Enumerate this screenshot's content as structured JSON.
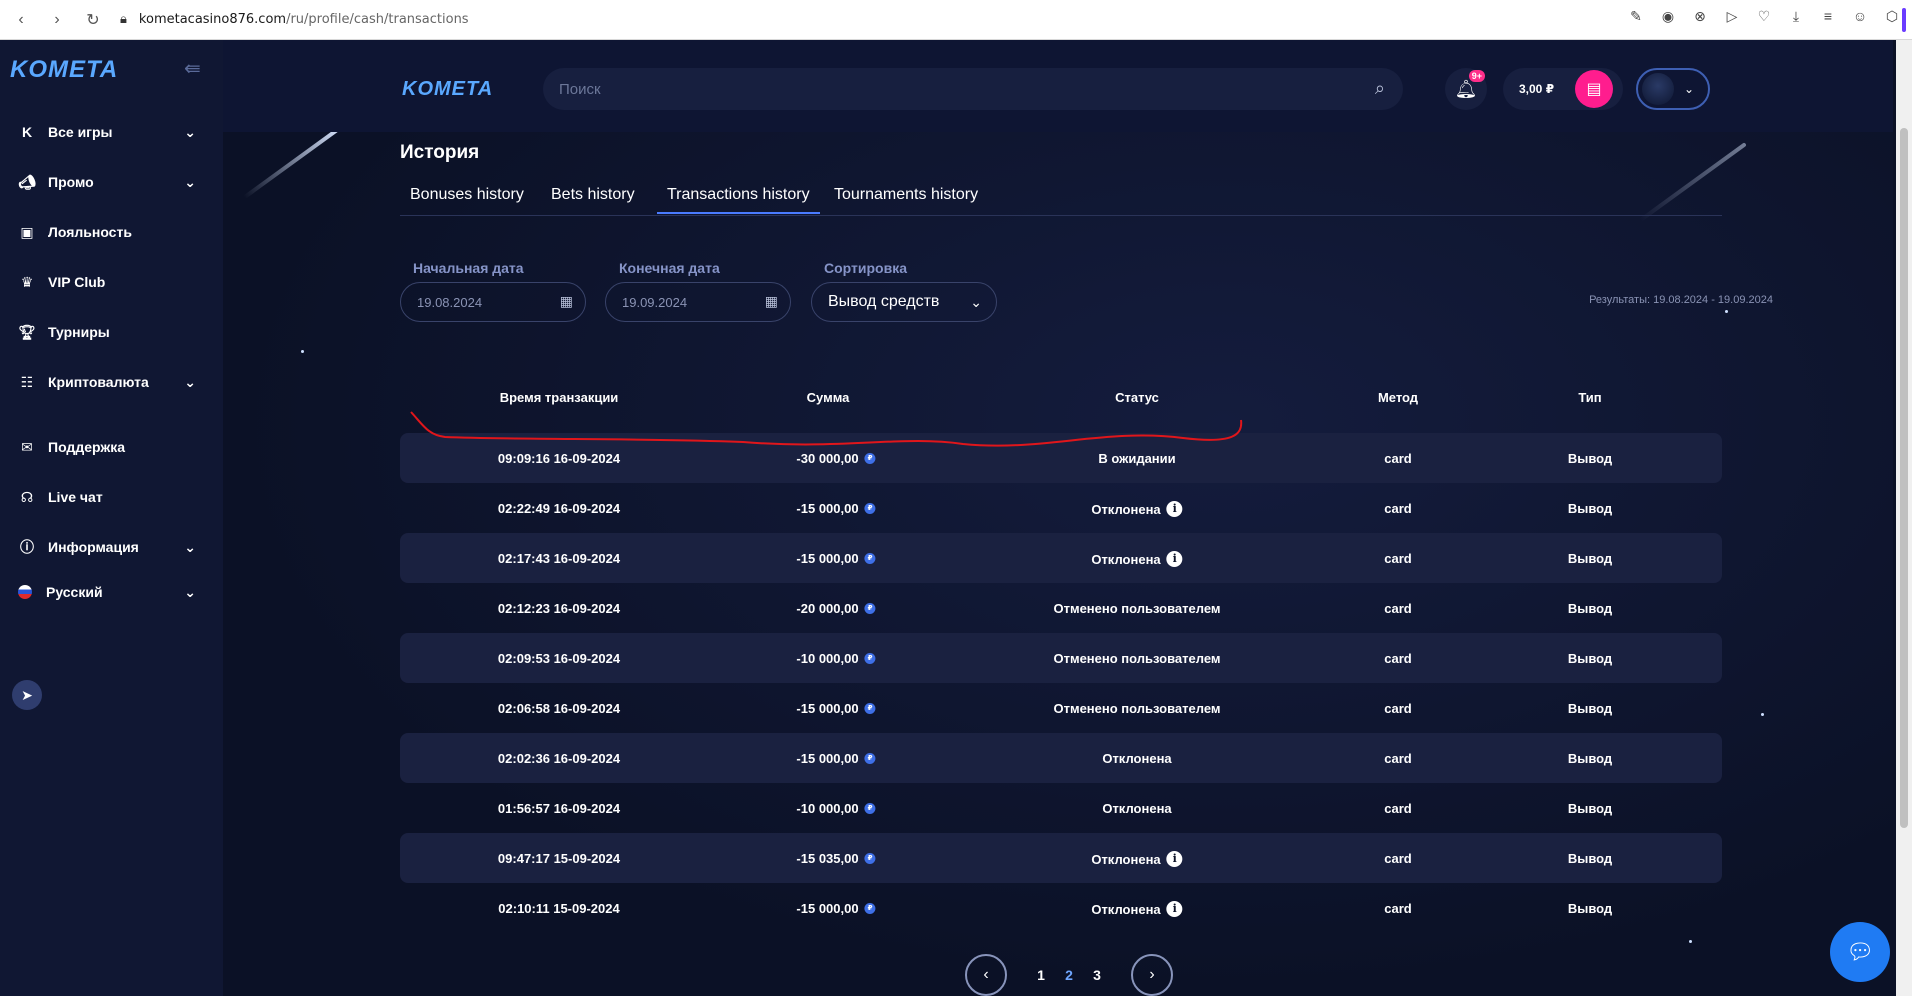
{
  "browser": {
    "url_host": "kometacasino876.com",
    "url_path": "/ru/profile/cash/transactions"
  },
  "brand": {
    "logo": "KOMETA"
  },
  "sidebar": {
    "items": [
      {
        "label": "Все игры",
        "icon": "k-icon",
        "expandable": true
      },
      {
        "label": "Промо",
        "icon": "megaphone-icon",
        "expandable": true
      },
      {
        "label": "Лояльность",
        "icon": "loyalty-icon",
        "expandable": false
      },
      {
        "label": "VIP Club",
        "icon": "crown-icon",
        "expandable": false
      },
      {
        "label": "Турниры",
        "icon": "trophy-icon",
        "expandable": false
      },
      {
        "label": "Криптовалюта",
        "icon": "crypto-icon",
        "expandable": true
      },
      {
        "label": "Поддержка",
        "icon": "support-icon",
        "expandable": false
      },
      {
        "label": "Live чат",
        "icon": "headset-icon",
        "expandable": false
      },
      {
        "label": "Информация",
        "icon": "info-icon",
        "expandable": true
      },
      {
        "label": "Русский",
        "icon": "flag-ru-icon",
        "expandable": true
      }
    ]
  },
  "header": {
    "search_placeholder": "Поиск",
    "notif_badge": "9+",
    "balance": "3,00 ₽"
  },
  "page": {
    "title": "История",
    "tabs": [
      {
        "label": "Bonuses history",
        "active": false
      },
      {
        "label": "Bets history",
        "active": false
      },
      {
        "label": "Transactions history",
        "active": true
      },
      {
        "label": "Tournaments history",
        "active": false
      }
    ]
  },
  "filters": {
    "start_label": "Начальная дата",
    "start_value": "19.08.2024",
    "end_label": "Конечная дата",
    "end_value": "19.09.2024",
    "sort_label": "Сортировка",
    "sort_value": "Вывод средств",
    "results": "Результаты: 19.08.2024 - 19.09.2024"
  },
  "table": {
    "columns": [
      "Время транзакции",
      "Сумма",
      "Статус",
      "Метод",
      "Тип"
    ],
    "rows": [
      {
        "time": "09:09:16 16-09-2024",
        "amount": "-30 000,00",
        "status": "В ожидании",
        "info": false,
        "method": "card",
        "type": "Вывод"
      },
      {
        "time": "02:22:49 16-09-2024",
        "amount": "-15 000,00",
        "status": "Отклонена",
        "info": true,
        "method": "card",
        "type": "Вывод"
      },
      {
        "time": "02:17:43 16-09-2024",
        "amount": "-15 000,00",
        "status": "Отклонена",
        "info": true,
        "method": "card",
        "type": "Вывод"
      },
      {
        "time": "02:12:23 16-09-2024",
        "amount": "-20 000,00",
        "status": "Отменено пользователем",
        "info": false,
        "method": "card",
        "type": "Вывод"
      },
      {
        "time": "02:09:53 16-09-2024",
        "amount": "-10 000,00",
        "status": "Отменено пользователем",
        "info": false,
        "method": "card",
        "type": "Вывод"
      },
      {
        "time": "02:06:58 16-09-2024",
        "amount": "-15 000,00",
        "status": "Отменено пользователем",
        "info": false,
        "method": "card",
        "type": "Вывод"
      },
      {
        "time": "02:02:36 16-09-2024",
        "amount": "-15 000,00",
        "status": "Отклонена",
        "info": false,
        "method": "card",
        "type": "Вывод"
      },
      {
        "time": "01:56:57 16-09-2024",
        "amount": "-10 000,00",
        "status": "Отклонена",
        "info": false,
        "method": "card",
        "type": "Вывод"
      },
      {
        "time": "09:47:17 15-09-2024",
        "amount": "-15 035,00",
        "status": "Отклонена",
        "info": true,
        "method": "card",
        "type": "Вывод"
      },
      {
        "time": "02:10:11 15-09-2024",
        "amount": "-15 000,00",
        "status": "Отклонена",
        "info": true,
        "method": "card",
        "type": "Вывод"
      }
    ]
  },
  "pagination": {
    "pages": [
      "1",
      "2",
      "3"
    ],
    "current": "2"
  },
  "colors": {
    "accent": "#4a7bff",
    "wallet": "#ff1d8e",
    "chat": "#1f7bf3",
    "annotation": "#e0161b"
  }
}
